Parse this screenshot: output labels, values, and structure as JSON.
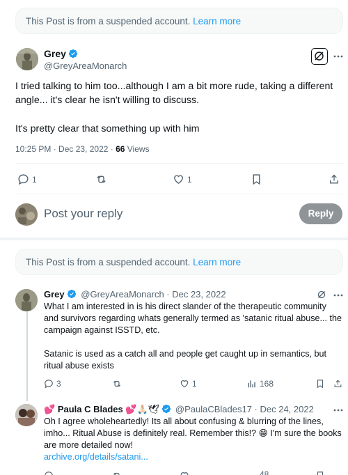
{
  "notice1": {
    "text": "This Post is from a suspended account.",
    "link": "Learn more"
  },
  "post": {
    "name": "Grey",
    "handle": "@GreyAreaMonarch",
    "body1": "I tried talking to him too...although I am a bit more rude, taking a different angle... it's clear he isn't willing to discuss.",
    "body2": "It's pretty clear that something up with him",
    "time": "10:25 PM · Dec 23, 2022 · ",
    "views_count": "66",
    "views_label": " Views",
    "reply_count": "1",
    "like_count": "1"
  },
  "composer": {
    "placeholder": "Post your reply",
    "button": "Reply"
  },
  "notice2": {
    "text": "This Post is from a suspended account.",
    "link": "Learn more"
  },
  "reply1": {
    "name": "Grey",
    "meta": "@GreyAreaMonarch · Dec 23, 2022",
    "body1": "What I am interested in is his direct slander of the therapeutic community and survivors regarding whats generally termed as 'satanic ritual abuse... the campaign against ISSTD, etc.",
    "body2": "Satanic is used as a catch all and people get caught up in semantics, but ritual abuse exists",
    "reply_count": "3",
    "like_count": "1",
    "views_count": "168"
  },
  "reply2": {
    "name": "Paula C Blades",
    "meta": "@PaulaCBlades17 · Dec 24, 2022",
    "body": "Oh I agree wholeheartedly! Its all about confusing & blurring of the lines, imho... Ritual Abuse is definitely real.  Remember this!? 😁 I'm sure the books are more detailed now!",
    "link": "archive.org/details/satani...",
    "views_partial": "48"
  },
  "colors": {
    "accent": "#1d9bf0",
    "muted": "#536471",
    "text": "#0f1419",
    "reply_button_bg": "#8f9499"
  }
}
